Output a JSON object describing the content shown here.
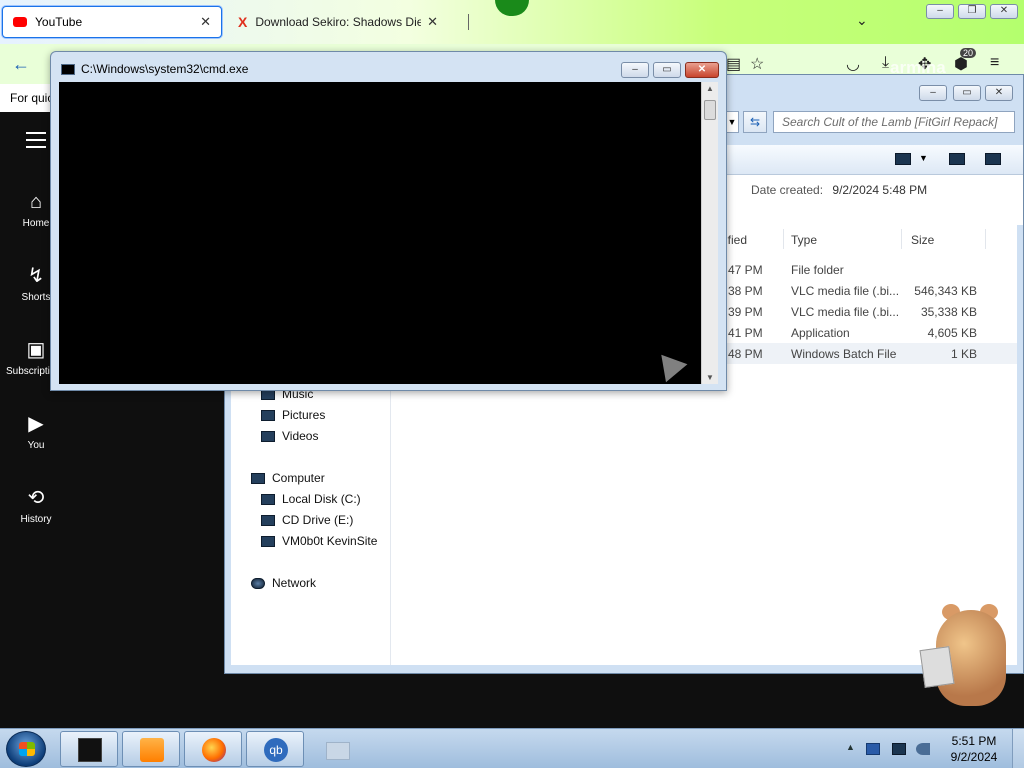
{
  "browser": {
    "tabs": [
      {
        "label": "YouTube",
        "close": "✕",
        "favicon_color": "#ff0000"
      },
      {
        "label": "Download Sekiro: Shadows Die",
        "close": "✕",
        "favicon_color": "#e0301e"
      }
    ],
    "tab_list_icon": "⌄",
    "bookmark_bar_text": "For quic",
    "badge_count": "20",
    "watermark": "armina"
  },
  "youtube": {
    "nav": [
      {
        "label": "Home",
        "icon": "⌂"
      },
      {
        "label": "Shorts",
        "icon": "↯"
      },
      {
        "label": "Subscriptions",
        "icon": "▣"
      },
      {
        "label": "You",
        "icon": "▶"
      },
      {
        "label": "History",
        "icon": "⟲"
      }
    ]
  },
  "explorer": {
    "search_placeholder": "Search Cult of the Lamb [FitGirl Repack]",
    "date_created_label": "Date created:",
    "date_created_value": "9/2/2024 5:48 PM",
    "columns": {
      "modified": "ified",
      "type": "Type",
      "size": "Size"
    },
    "files": [
      {
        "modified": "47 PM",
        "type": "File folder",
        "size": ""
      },
      {
        "modified": "38 PM",
        "type": "VLC media file (.bi...",
        "size": "546,343 KB"
      },
      {
        "modified": "39 PM",
        "type": "VLC media file (.bi...",
        "size": "35,338 KB"
      },
      {
        "modified": "41 PM",
        "type": "Application",
        "size": "4,605 KB"
      },
      {
        "modified": "48 PM",
        "type": "Windows Batch File",
        "size": "1 KB"
      }
    ],
    "nav_items": [
      {
        "label": "Music"
      },
      {
        "label": "Pictures"
      },
      {
        "label": "Videos"
      },
      {
        "label": "Computer"
      },
      {
        "label": "Local Disk (C:)"
      },
      {
        "label": "CD Drive (E:)"
      },
      {
        "label": "VM0b0t KevinSite"
      },
      {
        "label": "Network"
      }
    ]
  },
  "cmd": {
    "title": "C:\\Windows\\system32\\cmd.exe"
  },
  "taskbar": {
    "time": "5:51 PM",
    "date": "9/2/2024",
    "tray_arrow": "▲",
    "pinned": [
      "cmd",
      "vlc",
      "firefox",
      "qbittorrent",
      "explorer"
    ]
  }
}
